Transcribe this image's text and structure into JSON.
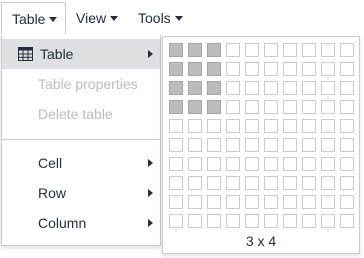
{
  "menubar": {
    "items": [
      {
        "label": "Table"
      },
      {
        "label": "View"
      },
      {
        "label": "Tools"
      }
    ]
  },
  "table_menu": {
    "items": [
      {
        "label": "Table",
        "icon": "table-icon",
        "has_submenu": true,
        "state": "selected"
      },
      {
        "label": "Table properties",
        "state": "disabled"
      },
      {
        "label": "Delete table",
        "state": "disabled"
      },
      {
        "label": "Cell",
        "has_submenu": true
      },
      {
        "label": "Row",
        "has_submenu": true
      },
      {
        "label": "Column",
        "has_submenu": true
      }
    ]
  },
  "table_picker": {
    "columns": 10,
    "rows": 10,
    "selected_cols": 3,
    "selected_rows": 4,
    "label": "3 x 4"
  },
  "colors": {
    "text": "#222f3e",
    "disabled_text": "#bdbdbd",
    "selected_bg": "#dee0e2",
    "border": "#cccccc",
    "cell_selected": "#bdbdbd"
  }
}
